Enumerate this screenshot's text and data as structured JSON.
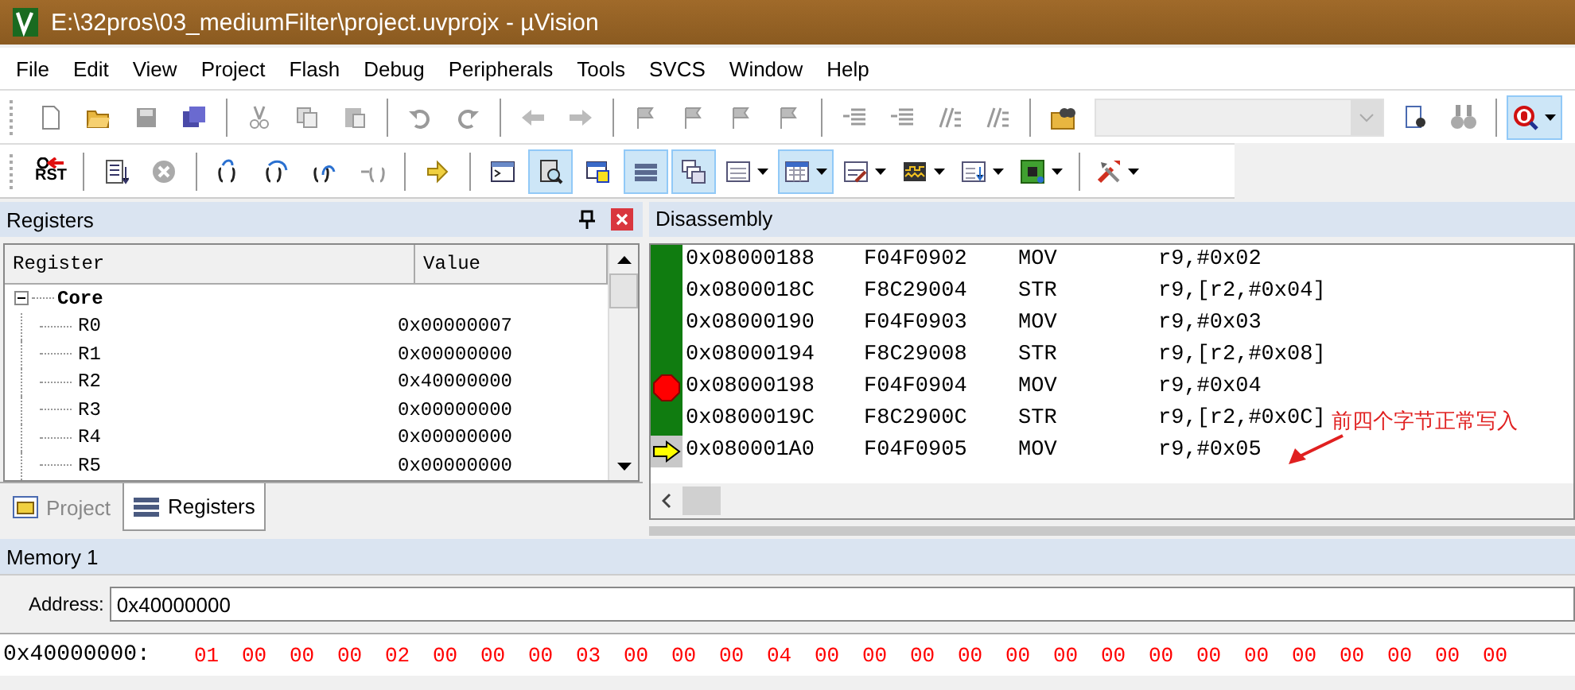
{
  "window": {
    "title": "E:\\32pros\\03_mediumFilter\\project.uvprojx - µVision"
  },
  "menu": [
    "File",
    "Edit",
    "View",
    "Project",
    "Flash",
    "Debug",
    "Peripherals",
    "Tools",
    "SVCS",
    "Window",
    "Help"
  ],
  "toolbar_1": [
    {
      "on": false
    },
    {
      "on": false
    },
    {
      "on": false
    },
    {
      "on": false
    },
    {
      "on": false
    },
    {
      "on": false
    },
    {
      "on": false
    },
    {
      "on": false
    },
    {
      "on": false
    },
    {
      "on": false
    },
    {
      "on": false
    },
    {
      "on": false
    },
    {
      "on": false
    },
    {
      "on": false
    },
    {
      "on": false
    },
    {
      "on": false
    },
    {
      "on": false
    },
    {
      "on": false
    },
    {
      "on": false
    },
    {
      "on": false
    },
    {
      "on": false
    },
    {
      "on": false
    },
    {
      "on": true
    }
  ],
  "toolbar_2": [
    {
      "label": "RST",
      "on": false
    },
    {
      "on": false
    },
    {
      "on": false
    },
    {
      "on": false
    },
    {
      "on": false
    },
    {
      "on": false
    },
    {
      "on": false
    },
    {
      "on": false
    },
    {
      "on": false
    },
    {
      "on": true
    },
    {
      "on": false
    },
    {
      "on": true
    },
    {
      "on": true
    },
    {
      "on": false
    },
    {
      "on": true
    },
    {
      "on": false
    },
    {
      "on": false
    },
    {
      "on": false
    },
    {
      "on": false
    },
    {
      "on": false
    }
  ],
  "registers": {
    "title": "Registers",
    "columns": [
      "Register",
      "Value"
    ],
    "tree": [
      {
        "name": "Core",
        "expanded": true,
        "children": [
          {
            "name": "R0",
            "value": "0x00000007"
          },
          {
            "name": "R1",
            "value": "0x00000000"
          },
          {
            "name": "R2",
            "value": "0x40000000"
          },
          {
            "name": "R3",
            "value": "0x00000000"
          },
          {
            "name": "R4",
            "value": "0x00000000"
          },
          {
            "name": "R5",
            "value": "0x00000000"
          }
        ]
      }
    ],
    "tabs": [
      {
        "label": "Project",
        "selected": false
      },
      {
        "label": "Registers",
        "selected": true
      }
    ]
  },
  "disassembly": {
    "title": "Disassembly",
    "rows": [
      {
        "address": "0x08000188",
        "opcode": "F04F0902",
        "mnemonic": "MOV",
        "operands": "r9,#0x02",
        "executed": true,
        "breakpoint": false,
        "current": false
      },
      {
        "address": "0x0800018C",
        "opcode": "F8C29004",
        "mnemonic": "STR",
        "operands": "r9,[r2,#0x04]",
        "executed": true,
        "breakpoint": false,
        "current": false
      },
      {
        "address": "0x08000190",
        "opcode": "F04F0903",
        "mnemonic": "MOV",
        "operands": "r9,#0x03",
        "executed": true,
        "breakpoint": false,
        "current": false
      },
      {
        "address": "0x08000194",
        "opcode": "F8C29008",
        "mnemonic": "STR",
        "operands": "r9,[r2,#0x08]",
        "executed": true,
        "breakpoint": false,
        "current": false
      },
      {
        "address": "0x08000198",
        "opcode": "F04F0904",
        "mnemonic": "MOV",
        "operands": "r9,#0x04",
        "executed": true,
        "breakpoint": true,
        "current": false
      },
      {
        "address": "0x0800019C",
        "opcode": "F8C2900C",
        "mnemonic": "STR",
        "operands": "r9,[r2,#0x0C]",
        "executed": true,
        "breakpoint": false,
        "current": false
      },
      {
        "address": "0x080001A0",
        "opcode": "F04F0905",
        "mnemonic": "MOV",
        "operands": "r9,#0x05",
        "executed": false,
        "breakpoint": false,
        "current": true
      }
    ],
    "annotation": "前四个字节正常写入"
  },
  "memory": {
    "title": "Memory 1",
    "address_label": "Address:",
    "address": "0x40000000",
    "row_address": "0x40000000:",
    "bytes": [
      "01",
      "00",
      "00",
      "00",
      "02",
      "00",
      "00",
      "00",
      "03",
      "00",
      "00",
      "00",
      "04",
      "00",
      "00",
      "00",
      "00",
      "00",
      "00",
      "00",
      "00",
      "00",
      "00",
      "00",
      "00",
      "00",
      "00",
      "00"
    ]
  }
}
